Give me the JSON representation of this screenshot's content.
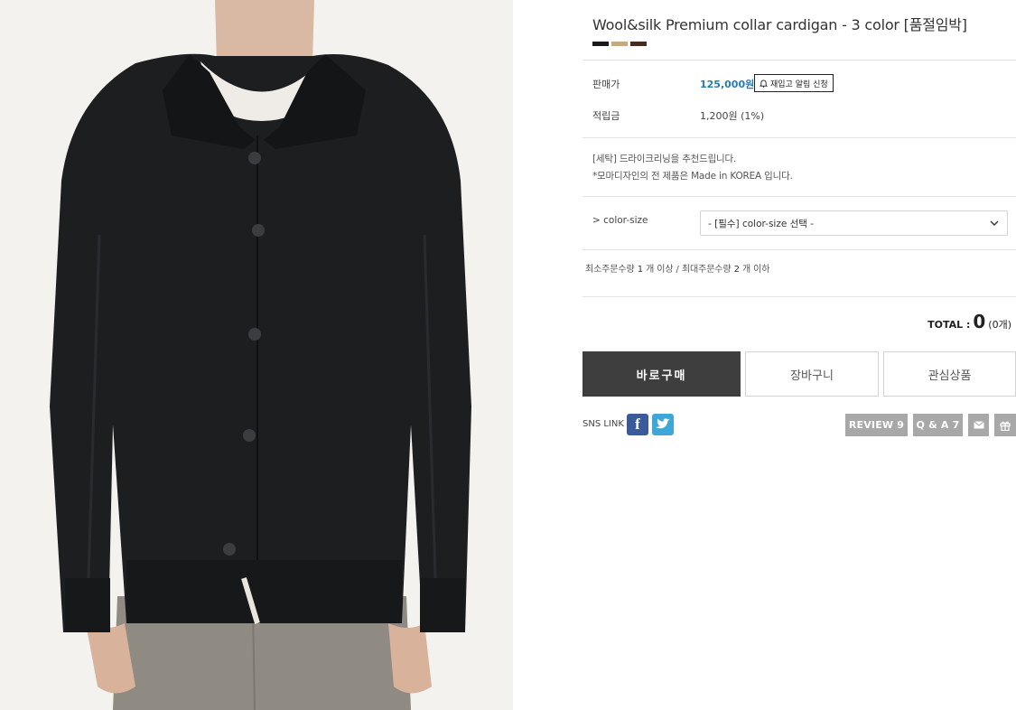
{
  "product": {
    "title": "Wool&silk Premium collar cardigan - 3 color [품절임박]",
    "color_swatches": [
      "#1a1a1a",
      "#c8a97e",
      "#4a2a1e"
    ]
  },
  "price": {
    "label": "판매가",
    "value": "125,000원",
    "restock_button": "재입고 알림 신청"
  },
  "points": {
    "label": "적립금",
    "value": "1,200원 (1%)"
  },
  "notes": [
    "[세탁] 드라이크리닝을 추천드립니다.",
    "*모마디자인의 전 제품은 Made in KOREA 입니다."
  ],
  "option": {
    "label": "> color-size",
    "selected": "- [필수] color-size 선택 -"
  },
  "quantity_limits": {
    "min_prefix": "최소주문수량",
    "min_value": "1",
    "min_suffix": "개 이상 /",
    "max_prefix": "최대주문수량",
    "max_value": "2",
    "max_suffix": "개 이하"
  },
  "total": {
    "label": "TOTAL :",
    "amount": "0",
    "count": "(0개)"
  },
  "actions": {
    "buy_now": "바로구매",
    "add_to_cart": "장바구니",
    "wishlist": "관심상품"
  },
  "sns": {
    "label": "SNS LINK",
    "facebook_icon": "facebook-icon",
    "twitter_icon": "twitter-icon"
  },
  "side_buttons": {
    "review": "REVIEW 9",
    "qa": "Q & A 7",
    "mail_icon": "mail-icon",
    "gift_icon": "gift-icon"
  }
}
